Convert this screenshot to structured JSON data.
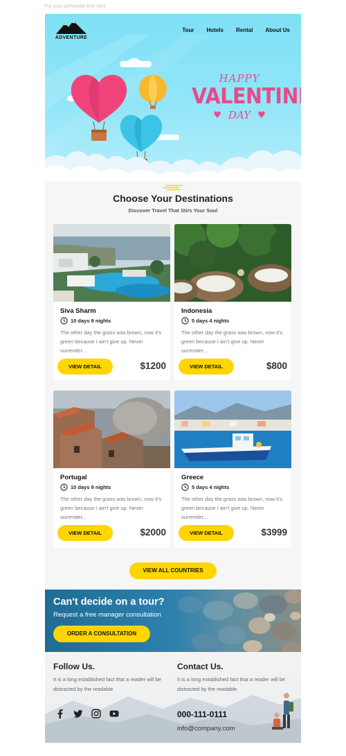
{
  "preheader": "Put your preheader text here",
  "brand": {
    "logo_text": "ADVENTURE"
  },
  "nav": [
    "Tour",
    "Hotels",
    "Rental",
    "About Us"
  ],
  "hero": {
    "happy": "HAPPY",
    "valentines": "VALENTINE'S",
    "day": "DAY"
  },
  "section": {
    "title": "Choose Your Destinations",
    "subtitle": "Discover Travel That Stirs Your Soul"
  },
  "cards": [
    {
      "name": "Siva Sharm",
      "duration": "10 days 9 nights",
      "desc": "The other day the grass was brown, now it's green because I ain't give up. Never surrender...",
      "button": "VIEW DETAIL",
      "price": "$1200"
    },
    {
      "name": "Indonesia",
      "duration": "5 days 4 nights",
      "desc": "The other day the grass was brown, now it's green because I ain't give up. Never surrender...",
      "button": "VIEW DETAIL",
      "price": "$800"
    },
    {
      "name": "Portugal",
      "duration": "10 days 9 nights",
      "desc": "The other day the grass was brown, now it's green because I ain't give up. Never surrender...",
      "button": "VIEW DETAIL",
      "price": "$2000"
    },
    {
      "name": "Greece",
      "duration": "5 days 4 nights",
      "desc": "The other day the grass was brown, now it's green because I ain't give up. Never surrender...",
      "button": "VIEW DETAIL",
      "price": "$3999"
    }
  ],
  "view_all": "VIEW ALL COUNTRIES",
  "cta": {
    "title": "Can't decide on a tour?",
    "subtitle": "Request a free manager consultation",
    "button": "ORDER A CONSULTATION"
  },
  "footer": {
    "follow_title": "Follow Us.",
    "follow_text": "It is a long established fact that a reader will be distracted by the readable",
    "contact_title": "Contact Us.",
    "contact_text": "It is a long established fact that a reader will be distracted by the readable",
    "phone": "000-111-0111",
    "email": "info@company.com",
    "social_icons": [
      "facebook-icon",
      "twitter-icon",
      "instagram-icon",
      "youtube-icon"
    ]
  },
  "colors": {
    "accent": "#ffd500",
    "hero_sky": "#7ee0f5",
    "valentine_pink": "#e84b8a"
  }
}
